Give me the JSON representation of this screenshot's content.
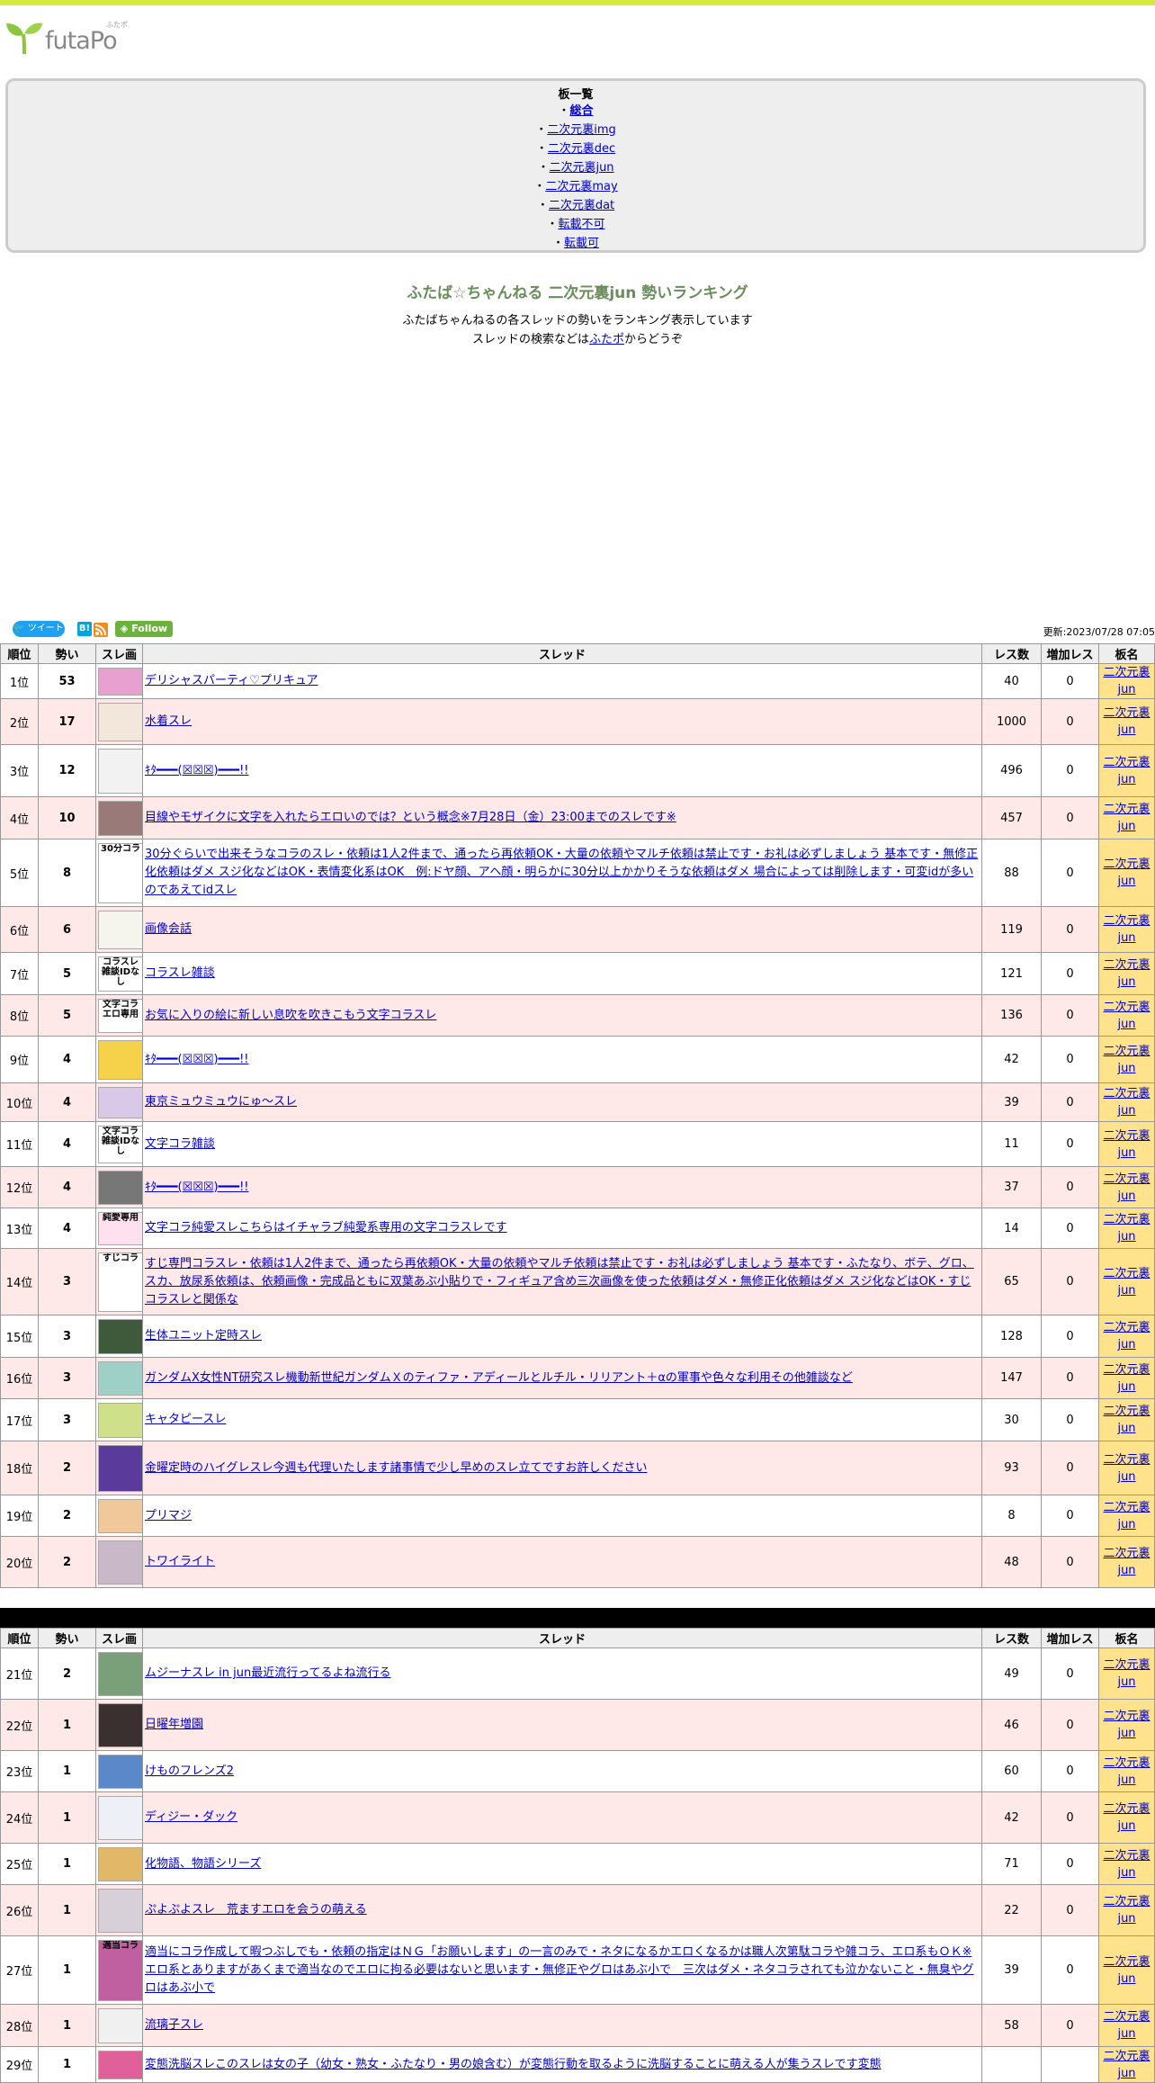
{
  "site": {
    "logo_text": "futaPo",
    "logo_kana": "ふたポ"
  },
  "boards": {
    "title": "板一覧",
    "items": [
      {
        "prefix": "・",
        "label": "総合",
        "bold": true
      },
      {
        "prefix": "・",
        "label": "二次元裏img"
      },
      {
        "prefix": "・",
        "label": "二次元裏dec"
      },
      {
        "prefix": "・",
        "label": "二次元裏jun"
      },
      {
        "prefix": "・",
        "label": "二次元裏may"
      },
      {
        "prefix": "・",
        "label": "二次元裏dat"
      },
      {
        "prefix": "・",
        "label": "転載不可"
      },
      {
        "prefix": "・",
        "label": "転載可"
      }
    ]
  },
  "page": {
    "title": "ふたば☆ちゃんねる 二次元裏jun 勢いランキング",
    "desc1": "ふたばちゃんねるの各スレッドの勢いをランキング表示しています",
    "desc2_pre": "スレッドの検索などは",
    "desc2_link": "ふたポ",
    "desc2_post": "からどうぞ"
  },
  "share": {
    "tweet": "ツイート",
    "hatena": "B!",
    "follow": "Follow",
    "updated": "更新:2023/07/28 07:05"
  },
  "table": {
    "headers": [
      "順位",
      "勢い",
      "スレ画",
      "スレッド",
      "レス数",
      "増加レス",
      "板名"
    ],
    "board_line1": "二次元裏",
    "board_line2": "jun"
  },
  "colors": {
    "topbar": "#d4ea3c",
    "title": "#6a8e5a",
    "row_alt": "#ffe8e8",
    "board_cell": "#ffe38c"
  },
  "rows": [
    {
      "rank": "1位",
      "ikioi": "53",
      "thread": "デリシャスパーティ♡プリキュア",
      "res": "40",
      "inc": "0",
      "thumb": "#e8a0d0"
    },
    {
      "rank": "2位",
      "ikioi": "17",
      "thread": "水着スレ",
      "res": "1000",
      "inc": "0",
      "thumb": "#f3e6da"
    },
    {
      "rank": "3位",
      "ikioi": "12",
      "thread": "ｷﾀ━━━(☒☒☒)━━━!!",
      "res": "496",
      "inc": "0",
      "thumb": "#f2f2f2"
    },
    {
      "rank": "4位",
      "ikioi": "10",
      "thread": "目線やモザイクに文字を入れたらエロいのでは？という概念※7月28日（金）23:00までのスレです※",
      "res": "457",
      "inc": "0",
      "thumb": "#9a7a78"
    },
    {
      "rank": "5位",
      "ikioi": "8",
      "thread": "30分ぐらいで出来そうなコラのスレ・依頼は1人2件まで、通ったら再依頼OK・大量の依頼やマルチ依頼は禁止です・お礼は必ずしましょう 基本です・無修正化依頼はダメ スジ化などはOK・表情変化系はOK　例:ドヤ顔、アヘ顔・明らかに30分以上かかりそうな依頼はダメ 場合によっては削除します・可変idが多いのであえてidスレ",
      "res": "88",
      "inc": "0",
      "thumb": "#ffffff",
      "thumb_text": "30分コラ"
    },
    {
      "rank": "6位",
      "ikioi": "6",
      "thread": "画像会話",
      "res": "119",
      "inc": "0",
      "thumb": "#f5f5ee"
    },
    {
      "rank": "7位",
      "ikioi": "5",
      "thread": "コラスレ雑談",
      "res": "121",
      "inc": "0",
      "thumb": "#ffffff",
      "thumb_text": "コラスレ雑談IDなし"
    },
    {
      "rank": "8位",
      "ikioi": "5",
      "thread": "お気に入りの絵に新しい息吹を吹きこもう文字コラスレ",
      "res": "136",
      "inc": "0",
      "thumb": "#ffffff",
      "thumb_text": "文字コラエロ専用"
    },
    {
      "rank": "9位",
      "ikioi": "4",
      "thread": "ｷﾀ━━━(☒☒☒)━━━!!",
      "res": "42",
      "inc": "0",
      "thumb": "#f6d24a"
    },
    {
      "rank": "10位",
      "ikioi": "4",
      "thread": "東京ミュウミュウにゅ～スレ",
      "res": "39",
      "inc": "0",
      "thumb": "#d9c8e8"
    },
    {
      "rank": "11位",
      "ikioi": "4",
      "thread": "文字コラ雑談",
      "res": "11",
      "inc": "0",
      "thumb": "#ffffff",
      "thumb_text": "文字コラ雑談IDなし"
    },
    {
      "rank": "12位",
      "ikioi": "4",
      "thread": "ｷﾀ━━━(☒☒☒)━━━!!",
      "res": "37",
      "inc": "0",
      "thumb": "#777777"
    },
    {
      "rank": "13位",
      "ikioi": "4",
      "thread": "文字コラ純愛スレこちらはイチャラブ純愛系専用の文字コラスレです",
      "res": "14",
      "inc": "0",
      "thumb": "#ffe0ee",
      "thumb_text": "純愛専用"
    },
    {
      "rank": "14位",
      "ikioi": "3",
      "thread": "すじ専門コラスレ・依頼は1人2件まで、通ったら再依頼OK・大量の依頼やマルチ依頼は禁止です・お礼は必ずしましょう 基本です・ふたなり、ボテ、グロ、スカ、放尿系依頼は、依頼画像・完成品ともに双葉あぶ小貼りで・フィギュア含め三次画像を使った依頼はダメ・無修正化依頼はダメ スジ化などはOK・すじコラスレと関係な",
      "res": "65",
      "inc": "0",
      "thumb": "#ffffff",
      "thumb_text": "すじコラ"
    },
    {
      "rank": "15位",
      "ikioi": "3",
      "thread": "生体ユニット定時スレ",
      "res": "128",
      "inc": "0",
      "thumb": "#3e5a3a"
    },
    {
      "rank": "16位",
      "ikioi": "3",
      "thread": "ガンダムX女性NT研究スレ機動新世紀ガンダムＸのティファ・アディールとルチル・リリアント＋αの軍事や色々な利用その他雑談など",
      "res": "147",
      "inc": "0",
      "thumb": "#9ed0c8"
    },
    {
      "rank": "17位",
      "ikioi": "3",
      "thread": "キャタピースレ",
      "res": "30",
      "inc": "0",
      "thumb": "#cfe08a"
    },
    {
      "rank": "18位",
      "ikioi": "2",
      "thread": "金曜定時のハイグレスレ今週も代理いたします諸事情で少し早めのスレ立てですお許しください",
      "res": "93",
      "inc": "0",
      "thumb": "#5a3a9a"
    },
    {
      "rank": "19位",
      "ikioi": "2",
      "thread": "プリマジ",
      "res": "8",
      "inc": "0",
      "thumb": "#f0c89a"
    },
    {
      "rank": "20位",
      "ikioi": "2",
      "thread": "トワイライト",
      "res": "48",
      "inc": "0",
      "thumb": "#c8b8c8"
    },
    {
      "rank": "21位",
      "ikioi": "2",
      "thread": "ムジーナスレ in jun最近流行ってるよね流行る",
      "res": "49",
      "inc": "0",
      "thumb": "#7aa07a"
    },
    {
      "rank": "22位",
      "ikioi": "1",
      "thread": "日曜年増園",
      "res": "46",
      "inc": "0",
      "thumb": "#3a3030"
    },
    {
      "rank": "23位",
      "ikioi": "1",
      "thread": "けものフレンズ2",
      "res": "60",
      "inc": "0",
      "thumb": "#5a88c8"
    },
    {
      "rank": "24位",
      "ikioi": "1",
      "thread": "ディジー・ダック",
      "res": "42",
      "inc": "0",
      "thumb": "#eef0f8"
    },
    {
      "rank": "25位",
      "ikioi": "1",
      "thread": "化物語、物語シリーズ",
      "res": "71",
      "inc": "0",
      "thumb": "#e0b868"
    },
    {
      "rank": "26位",
      "ikioi": "1",
      "thread": "ぷよぷよスレ　荒ますエロを会うの萌える",
      "res": "22",
      "inc": "0",
      "thumb": "#d8d0d8"
    },
    {
      "rank": "27位",
      "ikioi": "1",
      "thread": "適当にコラ作成して暇つぶしでも・依頼の指定はＮＧ「お願いします」の一言のみで・ネタになるかエロくなるかは職人次第駄コラや雑コラ、エロ系もＯＫ※エロ系とありますがあくまで適当なのでエロに拘る必要はないと思います・無修正やグロはあぶ小で　三次はダメ・ネタコラされても泣かないこと・無臭やグロはあぶ小で",
      "res": "39",
      "inc": "0",
      "thumb": "#c060a0",
      "thumb_text": "適当コラ"
    },
    {
      "rank": "28位",
      "ikioi": "1",
      "thread": "流璃子スレ",
      "res": "58",
      "inc": "0",
      "thumb": "#f0f0f0"
    },
    {
      "rank": "29位",
      "ikioi": "1",
      "thread": "変態洗脳スレこのスレは女の子（幼女・熟女・ふたなり・男の娘含む）が変態行動を取るように洗脳することに萌える人が集うスレです変態",
      "res": "",
      "inc": "",
      "thumb": "#e0609a"
    }
  ]
}
